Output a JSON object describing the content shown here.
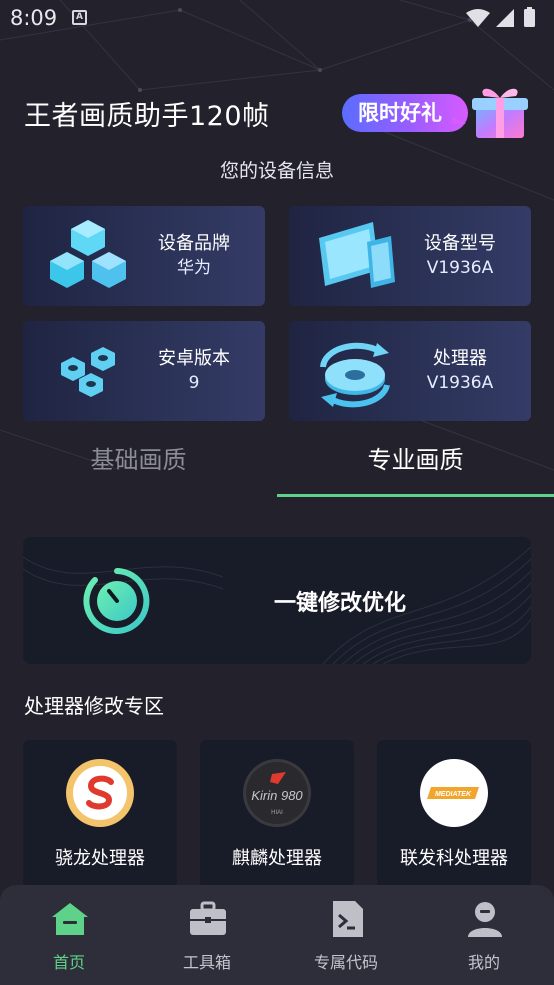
{
  "status_bar": {
    "time": "8:09",
    "notification_letter": "A"
  },
  "header": {
    "title": "王者画质助手120帧",
    "promo_label": "限时好礼"
  },
  "device_info": {
    "title": "您的设备信息",
    "cards": [
      {
        "label": "设备品牌",
        "value": "华为",
        "icon": "cubes-icon"
      },
      {
        "label": "设备型号",
        "value": "V1936A",
        "icon": "devices-icon"
      },
      {
        "label": "安卓版本",
        "value": "9",
        "icon": "nuts-icon"
      },
      {
        "label": "处理器",
        "value": "V1936A",
        "icon": "refresh-disc-icon"
      }
    ]
  },
  "tabs": [
    {
      "label": "基础画质",
      "active": false
    },
    {
      "label": "专业画质",
      "active": true
    }
  ],
  "optimize": {
    "label": "一键修改优化"
  },
  "processor_zone": {
    "title": "处理器修改专区",
    "items": [
      {
        "label": "骁龙处理器",
        "logo": "snapdragon-logo"
      },
      {
        "label": "麒麟处理器",
        "logo": "kirin-logo",
        "logo_text": "Kirin 980",
        "logo_subtext": "HIAI"
      },
      {
        "label": "联发科处理器",
        "logo": "mediatek-logo",
        "logo_text": "MEDIATEK"
      }
    ]
  },
  "bottom_nav": [
    {
      "label": "首页",
      "icon": "home-icon",
      "active": true
    },
    {
      "label": "工具箱",
      "icon": "toolbox-icon",
      "active": false
    },
    {
      "label": "专属代码",
      "icon": "code-file-icon",
      "active": false
    },
    {
      "label": "我的",
      "icon": "user-icon",
      "active": false
    }
  ],
  "colors": {
    "background": "#23222c",
    "accent": "#5fd28a",
    "card": "#2c3358",
    "promo_start": "#5b6dff",
    "promo_end": "#d85bff"
  }
}
